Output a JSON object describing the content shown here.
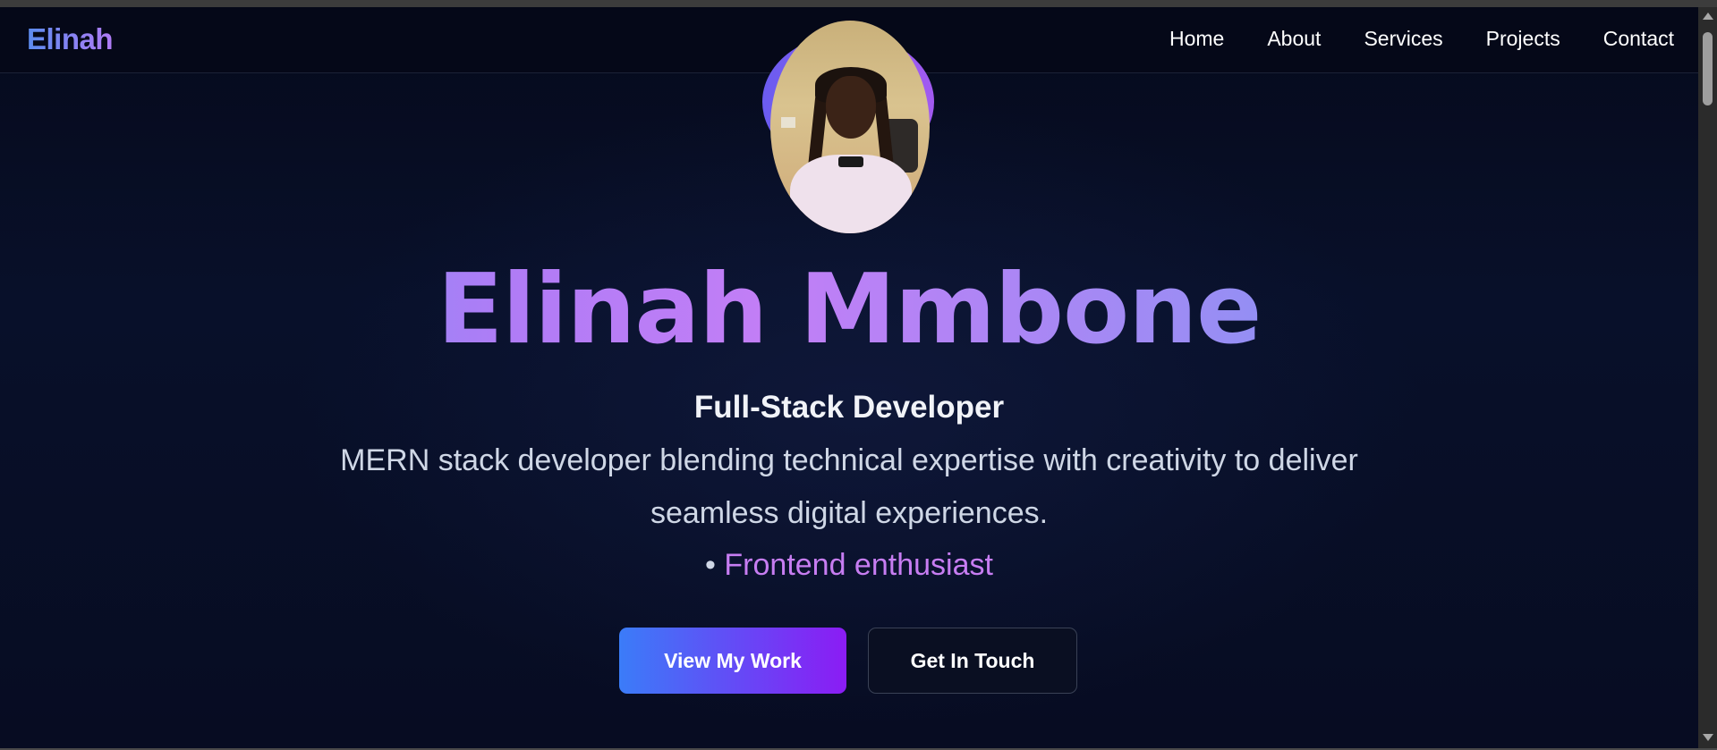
{
  "navbar": {
    "logo": "Elinah",
    "links": [
      "Home",
      "About",
      "Services",
      "Projects",
      "Contact"
    ]
  },
  "hero": {
    "name": "Elinah Mmbone",
    "role": "Full-Stack Developer",
    "description": "MERN stack developer blending technical expertise with creativity to deliver seamless digital experiences.",
    "tag_bullet": "•",
    "tag": "Frontend enthusiast",
    "primary_button": "View My Work",
    "secondary_button": "Get In Touch"
  },
  "colors": {
    "background": "#070c22",
    "accent_blue": "#3b7cf8",
    "accent_purple": "#8b1cf4",
    "tag_color": "#c77df2"
  }
}
